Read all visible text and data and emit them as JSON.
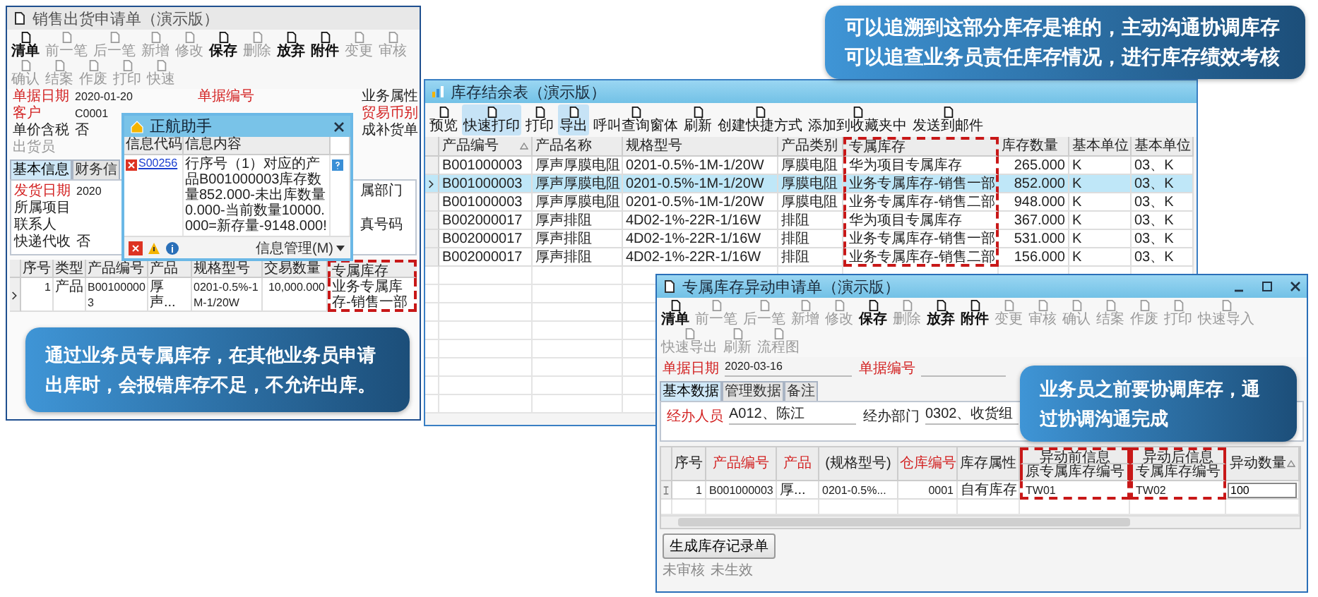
{
  "sales_window": {
    "title": "销售出货申请单（演示版）",
    "toolbar": [
      {
        "label": "清单",
        "disabled": false
      },
      {
        "label": "前一笔",
        "disabled": true
      },
      {
        "label": "后一笔",
        "disabled": true
      },
      {
        "label": "新增",
        "disabled": true
      },
      {
        "label": "修改",
        "disabled": true
      },
      {
        "label": "保存",
        "disabled": false
      },
      {
        "label": "删除",
        "disabled": true
      },
      {
        "label": "放弃",
        "disabled": false
      },
      {
        "label": "附件",
        "disabled": false
      },
      {
        "label": "变更",
        "disabled": true
      },
      {
        "label": "审核",
        "disabled": true
      },
      {
        "label": "确认",
        "disabled": true
      },
      {
        "label": "结案",
        "disabled": true
      },
      {
        "label": "作废",
        "disabled": true
      },
      {
        "label": "打印",
        "disabled": true
      },
      {
        "label": "快速",
        "disabled": true
      }
    ],
    "form_rows": [
      {
        "label": {
          "text": "单据日期",
          "required": true,
          "disabled": false
        },
        "value": "2020-01-20",
        "middle": {
          "text": "单据编号",
          "required": true,
          "disabled": false
        },
        "right": {
          "text": "业务属性",
          "required": false,
          "disabled": false
        }
      },
      {
        "label": {
          "text": "客户",
          "required": true,
          "disabled": false
        },
        "value": "C0001",
        "right": {
          "text": "贸易币别",
          "required": true,
          "disabled": false
        }
      },
      {
        "label": {
          "text": "单价含税",
          "required": false,
          "disabled": false
        },
        "value": "否",
        "right": {
          "text": "成补货单",
          "required": false,
          "disabled": false
        }
      },
      {
        "label": {
          "text": "出货员",
          "required": false,
          "disabled": true
        }
      }
    ],
    "tabs": [
      {
        "label": "基本信息",
        "selected": true
      },
      {
        "label": "财务信",
        "selected": false
      }
    ],
    "tab_rows": [
      {
        "label": {
          "text": "发货日期",
          "required": true,
          "disabled": false
        },
        "value": "2020",
        "right": {
          "text": "属部门",
          "required": false,
          "disabled": false
        }
      },
      {
        "label": {
          "text": "所属项目",
          "required": false,
          "disabled": false
        }
      },
      {
        "label": {
          "text": "联系人",
          "required": false,
          "disabled": false
        },
        "right": {
          "text": "真号码",
          "required": false,
          "disabled": false
        }
      },
      {
        "label": {
          "text": "快递代收",
          "required": false,
          "disabled": false
        },
        "value": "否"
      }
    ],
    "grid": {
      "columns": [
        {
          "label": "序号",
          "highlighted": false
        },
        {
          "label": "类型",
          "highlighted": false
        },
        {
          "label": "产品编号",
          "highlighted": false
        },
        {
          "label": "产品",
          "highlighted": false
        },
        {
          "label": "规格型号",
          "highlighted": false
        },
        {
          "label": "交易数量",
          "highlighted": false
        },
        {
          "label": "专属库存",
          "highlighted": true
        }
      ],
      "rows": [
        {
          "selected": true,
          "cells": [
            "1",
            "产品",
            "B001000003",
            "厚声...",
            "0201-0.5%-1M-1/20W",
            "10,000.000",
            "业务专属库存-销售一部"
          ]
        }
      ]
    },
    "callout": "通过业务员专属库存，在其他业务员申请出库时，会报错库存不足，不允许出库。"
  },
  "assistant_dialog": {
    "title": "正航助手",
    "columns": [
      "信息代码",
      "信息内容"
    ],
    "messages": [
      {
        "code": "S00256",
        "text": "行序号（1）对应的产品B001000003库存数量852.000-未出库数量0.000-当前数量10000.000=新存量-9148.000!"
      }
    ],
    "footer_menu": "信息管理(M)"
  },
  "stock_window": {
    "title": "库存结余表（演示版）",
    "toolbar": [
      {
        "label": "预览",
        "highlighted": false
      },
      {
        "label": "快速打印",
        "highlighted": true
      },
      {
        "label": "打印",
        "highlighted": false
      },
      {
        "label": "导出",
        "highlighted": true
      },
      {
        "label": "呼叫查询窗体",
        "highlighted": false
      },
      {
        "label": "刷新",
        "highlighted": false
      },
      {
        "label": "创建快捷方式",
        "highlighted": false
      },
      {
        "label": "添加到收藏夹中",
        "highlighted": false
      },
      {
        "label": "发送到邮件",
        "highlighted": false
      }
    ],
    "columns": [
      {
        "label": "产品编号",
        "sorted": true,
        "highlighted": false
      },
      {
        "label": "产品名称",
        "sorted": false,
        "highlighted": false
      },
      {
        "label": "规格型号",
        "sorted": false,
        "highlighted": false
      },
      {
        "label": "产品类别",
        "sorted": false,
        "highlighted": false
      },
      {
        "label": "专属库存",
        "sorted": false,
        "highlighted": true
      },
      {
        "label": "库存数量",
        "sorted": false,
        "highlighted": false
      },
      {
        "label": "基本单位",
        "sorted": false,
        "highlighted": false
      },
      {
        "label": "基本单位",
        "sorted": false,
        "highlighted": false
      }
    ],
    "rows": [
      {
        "selected": false,
        "cells": [
          "B001000003",
          "厚声厚膜电阻",
          "0201-0.5%-1M-1/20W",
          "厚膜电阻",
          "华为项目专属库存",
          "265.000",
          "K",
          "03、K"
        ]
      },
      {
        "selected": true,
        "cells": [
          "B001000003",
          "厚声厚膜电阻",
          "0201-0.5%-1M-1/20W",
          "厚膜电阻",
          "业务专属库存-销售一部",
          "852.000",
          "K",
          "03、K"
        ]
      },
      {
        "selected": false,
        "cells": [
          "B001000003",
          "厚声厚膜电阻",
          "0201-0.5%-1M-1/20W",
          "厚膜电阻",
          "业务专属库存-销售二部",
          "948.000",
          "K",
          "03、K"
        ]
      },
      {
        "selected": false,
        "cells": [
          "B002000017",
          "厚声排阻",
          "4D02-1%-22R-1/16W",
          "排阻",
          "华为项目专属库存",
          "367.000",
          "K",
          "03、K"
        ]
      },
      {
        "selected": false,
        "cells": [
          "B002000017",
          "厚声排阻",
          "4D02-1%-22R-1/16W",
          "排阻",
          "业务专属库存-销售一部",
          "531.000",
          "K",
          "03、K"
        ]
      },
      {
        "selected": false,
        "cells": [
          "B002000017",
          "厚声排阻",
          "4D02-1%-22R-1/16W",
          "排阻",
          "业务专属库存-销售二部",
          "156.000",
          "K",
          "03、K"
        ]
      }
    ],
    "callout": [
      "可以追溯到这部分库存是谁的，主动沟通协调库存",
      "可以追查业务员责任库存情况，进行库存绩效考核"
    ]
  },
  "transfer_window": {
    "title": "专属库存异动申请单（演示版）",
    "toolbar": [
      {
        "label": "清单",
        "disabled": false
      },
      {
        "label": "前一笔",
        "disabled": true
      },
      {
        "label": "后一笔",
        "disabled": true
      },
      {
        "label": "新增",
        "disabled": true
      },
      {
        "label": "修改",
        "disabled": true
      },
      {
        "label": "保存",
        "disabled": false
      },
      {
        "label": "删除",
        "disabled": true
      },
      {
        "label": "放弃",
        "disabled": false
      },
      {
        "label": "附件",
        "disabled": false
      },
      {
        "label": "变更",
        "disabled": true
      },
      {
        "label": "审核",
        "disabled": true
      },
      {
        "label": "确认",
        "disabled": true
      },
      {
        "label": "结案",
        "disabled": true
      },
      {
        "label": "作废",
        "disabled": true
      },
      {
        "label": "打印",
        "disabled": true
      },
      {
        "label": "快速导入",
        "disabled": true
      },
      {
        "label": "快速导出",
        "disabled": true
      },
      {
        "label": "刷新",
        "disabled": true
      },
      {
        "label": "流程图",
        "disabled": true
      }
    ],
    "header_fields": [
      {
        "label": "单据日期",
        "required": true,
        "value": "2020-03-16"
      },
      {
        "label": "单据编号",
        "required": true
      }
    ],
    "tabs": [
      {
        "label": "基本数据",
        "selected": true
      },
      {
        "label": "管理数据",
        "selected": false
      },
      {
        "label": "备注",
        "selected": false
      }
    ],
    "fields": [
      {
        "label": "经办人员",
        "required": true,
        "value": "A012、陈江"
      },
      {
        "label": "经办部门",
        "required": false,
        "value": "0302、收货组"
      }
    ],
    "columns": [
      {
        "label": "序号",
        "required": false,
        "sorted": false,
        "highlighted": false,
        "kind": "text"
      },
      {
        "label": "产品编号",
        "required": true,
        "sorted": false,
        "highlighted": false,
        "kind": "text"
      },
      {
        "label": "产品",
        "required": true,
        "sorted": false,
        "highlighted": false,
        "kind": "text"
      },
      {
        "label": "(规格型号)",
        "required": false,
        "sorted": false,
        "highlighted": false,
        "kind": "text"
      },
      {
        "label": "仓库编号",
        "required": true,
        "sorted": false,
        "highlighted": false,
        "kind": "text"
      },
      {
        "label": "库存属性",
        "required": false,
        "sorted": false,
        "highlighted": false,
        "kind": "text"
      },
      {
        "label": "异动前信息",
        "sub_label": "原专属库存编号",
        "required": false,
        "sorted": false,
        "highlighted": true,
        "kind": "text"
      },
      {
        "label": "异动后信息",
        "sub_label": "专属库存编号",
        "required": false,
        "sorted": false,
        "highlighted": true,
        "kind": "text"
      },
      {
        "label": "异动数量",
        "required": false,
        "sorted": true,
        "highlighted": false,
        "kind": "input"
      }
    ],
    "rows": [
      {
        "selected": true,
        "cells": [
          "1",
          "B001000003",
          "厚...",
          "0201-0.5%...",
          "0001",
          "自有库存",
          "TW01",
          "TW02",
          "100"
        ]
      }
    ],
    "action_button": "生成库存记录单",
    "status": [
      "未审核",
      "未生效"
    ],
    "callout": "业务员之前要协调库存，通过协调沟通完成"
  }
}
